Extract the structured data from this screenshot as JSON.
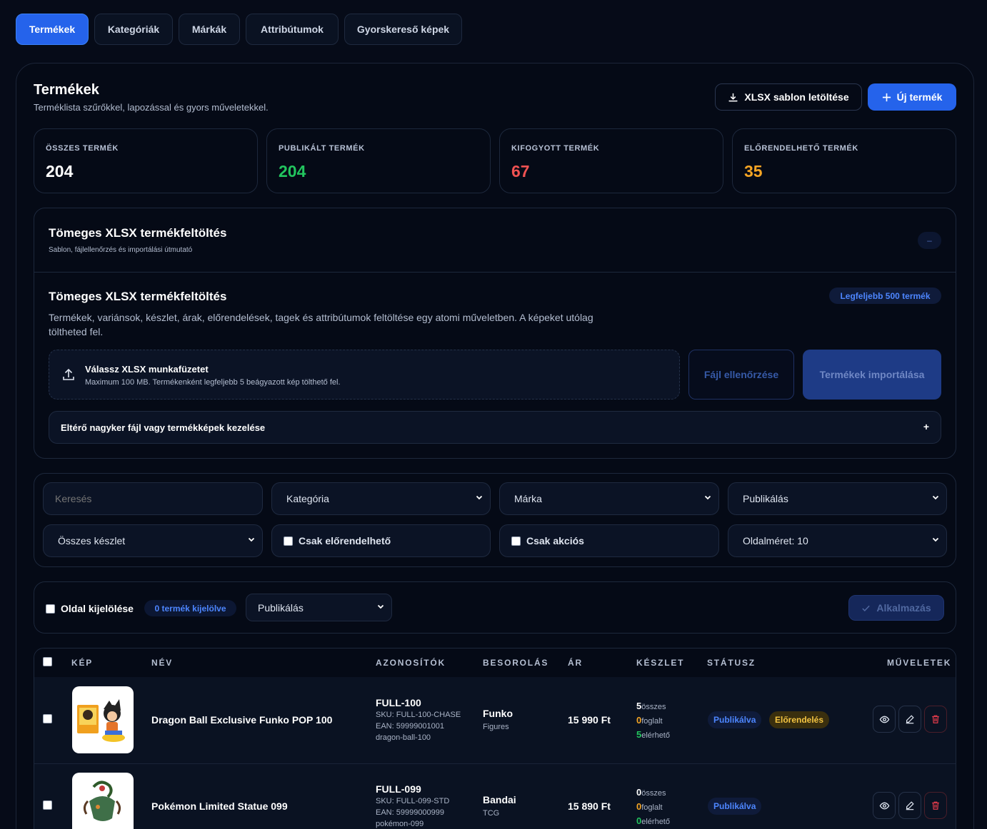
{
  "tabs": [
    {
      "label": "Termékek",
      "active": true
    },
    {
      "label": "Kategóriák",
      "active": false
    },
    {
      "label": "Márkák",
      "active": false
    },
    {
      "label": "Attribútumok",
      "active": false
    },
    {
      "label": "Gyorskereső képek",
      "active": false
    }
  ],
  "header": {
    "title": "Termékek",
    "subtitle": "Terméklista szűrőkkel, lapozással és gyors műveletekkel.",
    "download_label": "XLSX sablon letöltése",
    "new_label": "Új termék"
  },
  "stats": [
    {
      "label": "ÖSSZES TERMÉK",
      "value": "204",
      "color": "#ffffff"
    },
    {
      "label": "PUBLIKÁLT TERMÉK",
      "value": "204",
      "color": "#22c55e"
    },
    {
      "label": "KIFOGYOTT TERMÉK",
      "value": "67",
      "color": "#f05252"
    },
    {
      "label": "ELŐRENDELHETŐ TERMÉK",
      "value": "35",
      "color": "#f5a524"
    }
  ],
  "upload": {
    "section_title": "Tömeges XLSX termékfeltöltés",
    "section_subtitle": "Sablon, fájlellenőrzés és importálási útmutató",
    "collapse_label": "–",
    "title": "Tömeges XLSX termékfeltöltés",
    "limit_badge": "Legfeljebb 500 termék",
    "description": "Termékek, variánsok, készlet, árak, előrendelések, tagek és attribútumok feltöltése egy atomi műveletben. A képeket utólag töltheted fel.",
    "dropzone_title": "Válassz XLSX munkafüzetet",
    "dropzone_hint": "Maximum 100 MB. Termékenként legfeljebb 5 beágyazott kép tölthető fel.",
    "check_label": "Fájl ellenőrzése",
    "import_label": "Termékek importálása",
    "alt_label": "Eltérő nagyker fájl vagy termékképek kezelése",
    "alt_toggle": "+"
  },
  "filters": {
    "search_placeholder": "Keresés",
    "category": "Kategória",
    "brand": "Márka",
    "publish": "Publikálás",
    "stock": "Összes készlet",
    "preorder_only": "Csak előrendelhető",
    "sale_only": "Csak akciós",
    "page_size": "Oldalméret: 10"
  },
  "bulk": {
    "select_page": "Oldal kijelölése",
    "selected_badge": "0 termék kijelölve",
    "action": "Publikálás",
    "apply": "Alkalmazás"
  },
  "table": {
    "headers": [
      "KÉP",
      "NÉV",
      "AZONOSÍTÓK",
      "BESOROLÁS",
      "ÁR",
      "KÉSZLET",
      "STÁTUSZ",
      "MŰVELETEK"
    ],
    "rows": [
      {
        "name": "Dragon Ball Exclusive Funko POP 100",
        "code": "FULL-100",
        "sku": "SKU: FULL-100-CHASE",
        "ean": "EAN: 59999001001",
        "slug": "dragon-ball-100",
        "brand": "Funko",
        "category": "Figures",
        "price": "15 990 Ft",
        "stock_total": "5",
        "stock_total_label": "összes",
        "stock_reserved": "0",
        "stock_reserved_label": "foglalt",
        "stock_available": "5",
        "stock_available_label": "elérhető",
        "status": "Publikálva",
        "preorder": "Előrendelés"
      },
      {
        "name": "Pokémon Limited Statue 099",
        "code": "FULL-099",
        "sku": "SKU: FULL-099-STD",
        "ean": "EAN: 59999000999",
        "slug": "pokémon-099",
        "brand": "Bandai",
        "category": "TCG",
        "price": "15 890 Ft",
        "stock_total": "0",
        "stock_total_label": "összes",
        "stock_reserved": "0",
        "stock_reserved_label": "foglalt",
        "stock_available": "0",
        "stock_available_label": "elérhető",
        "status": "Publikálva",
        "preorder": ""
      }
    ]
  }
}
